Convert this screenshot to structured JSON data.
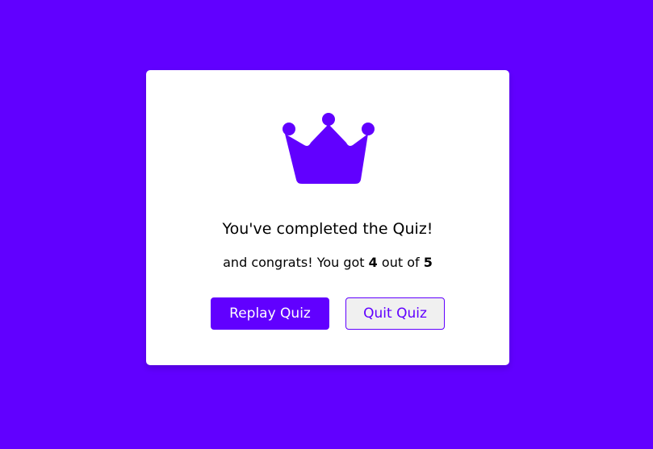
{
  "result": {
    "icon": "crown-icon",
    "complete_text": "You've completed the Quiz!",
    "score_prefix": "and congrats! You got",
    "score_value": "4",
    "score_middle": "out of",
    "score_total": "5",
    "replay_label": "Replay Quiz",
    "quit_label": "Quit Quiz"
  },
  "colors": {
    "accent": "#6100ff",
    "card": "#ffffff",
    "quit_bg": "#f0f0f0"
  }
}
